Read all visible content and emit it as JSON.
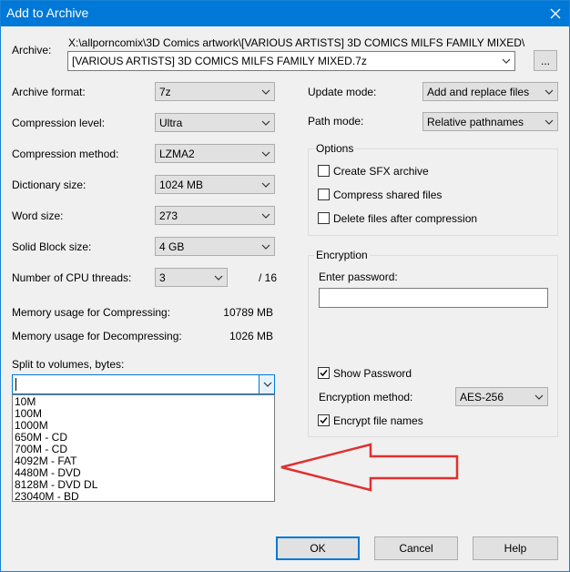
{
  "window": {
    "title": "Add to Archive"
  },
  "archive": {
    "label": "Archive:",
    "path": "X:\\allporncomix\\3D Comics artwork\\[VARIOUS ARTISTS] 3D COMICS MILFS FAMILY MIXED\\",
    "filename": "[VARIOUS ARTISTS] 3D COMICS MILFS FAMILY MIXED.7z",
    "browse_label": "..."
  },
  "left": {
    "archive_format": {
      "label": "Archive format:",
      "value": "7z"
    },
    "compression_level": {
      "label": "Compression level:",
      "value": "Ultra"
    },
    "compression_method": {
      "label": "Compression method:",
      "value": "LZMA2"
    },
    "dictionary_size": {
      "label": "Dictionary size:",
      "value": "1024 MB"
    },
    "word_size": {
      "label": "Word size:",
      "value": "273"
    },
    "solid_block_size": {
      "label": "Solid Block size:",
      "value": "4 GB"
    },
    "cpu_threads": {
      "label": "Number of CPU threads:",
      "value": "3",
      "max": "/ 16"
    },
    "mem_compress": {
      "label": "Memory usage for Compressing:",
      "value": "10789 MB"
    },
    "mem_decompress": {
      "label": "Memory usage for Decompressing:",
      "value": "1026 MB"
    },
    "split": {
      "label": "Split to volumes, bytes:",
      "value": "",
      "options": [
        "10M",
        "100M",
        "1000M",
        "650M - CD",
        "700M - CD",
        "4092M - FAT",
        "4480M - DVD",
        "8128M - DVD DL",
        "23040M - BD"
      ]
    }
  },
  "right": {
    "update_mode": {
      "label": "Update mode:",
      "value": "Add and replace files"
    },
    "path_mode": {
      "label": "Path mode:",
      "value": "Relative pathnames"
    },
    "options": {
      "title": "Options",
      "create_sfx": "Create SFX archive",
      "compress_shared": "Compress shared files",
      "delete_after": "Delete files after compression"
    },
    "encryption": {
      "title": "Encryption",
      "enter_password": "Enter password:",
      "show_password": "Show Password",
      "method_label": "Encryption method:",
      "method_value": "AES-256",
      "encrypt_names": "Encrypt file names"
    }
  },
  "buttons": {
    "ok": "OK",
    "cancel": "Cancel",
    "help": "Help"
  },
  "annotation": {
    "color": "#e03030"
  }
}
